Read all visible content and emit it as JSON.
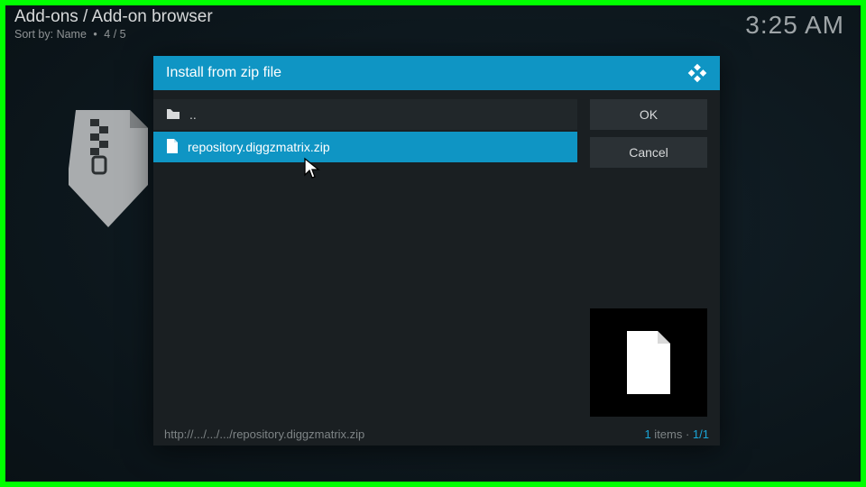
{
  "header": {
    "breadcrumb": "Add-ons / Add-on browser",
    "sort_prefix": "Sort by:",
    "sort_value": "Name",
    "page_indicator": "4 / 5",
    "clock": "3:25 AM"
  },
  "dialog": {
    "title": "Install from zip file",
    "items": [
      {
        "icon": "folder-up",
        "label": ".."
      },
      {
        "icon": "file",
        "label": "repository.diggzmatrix.zip",
        "selected": true
      }
    ],
    "buttons": {
      "ok": "OK",
      "cancel": "Cancel"
    },
    "footer_path": "http://.../.../.../repository.diggzmatrix.zip",
    "footer_count_num": "1",
    "footer_count_label": " items · ",
    "footer_count_pos": "1/1"
  }
}
